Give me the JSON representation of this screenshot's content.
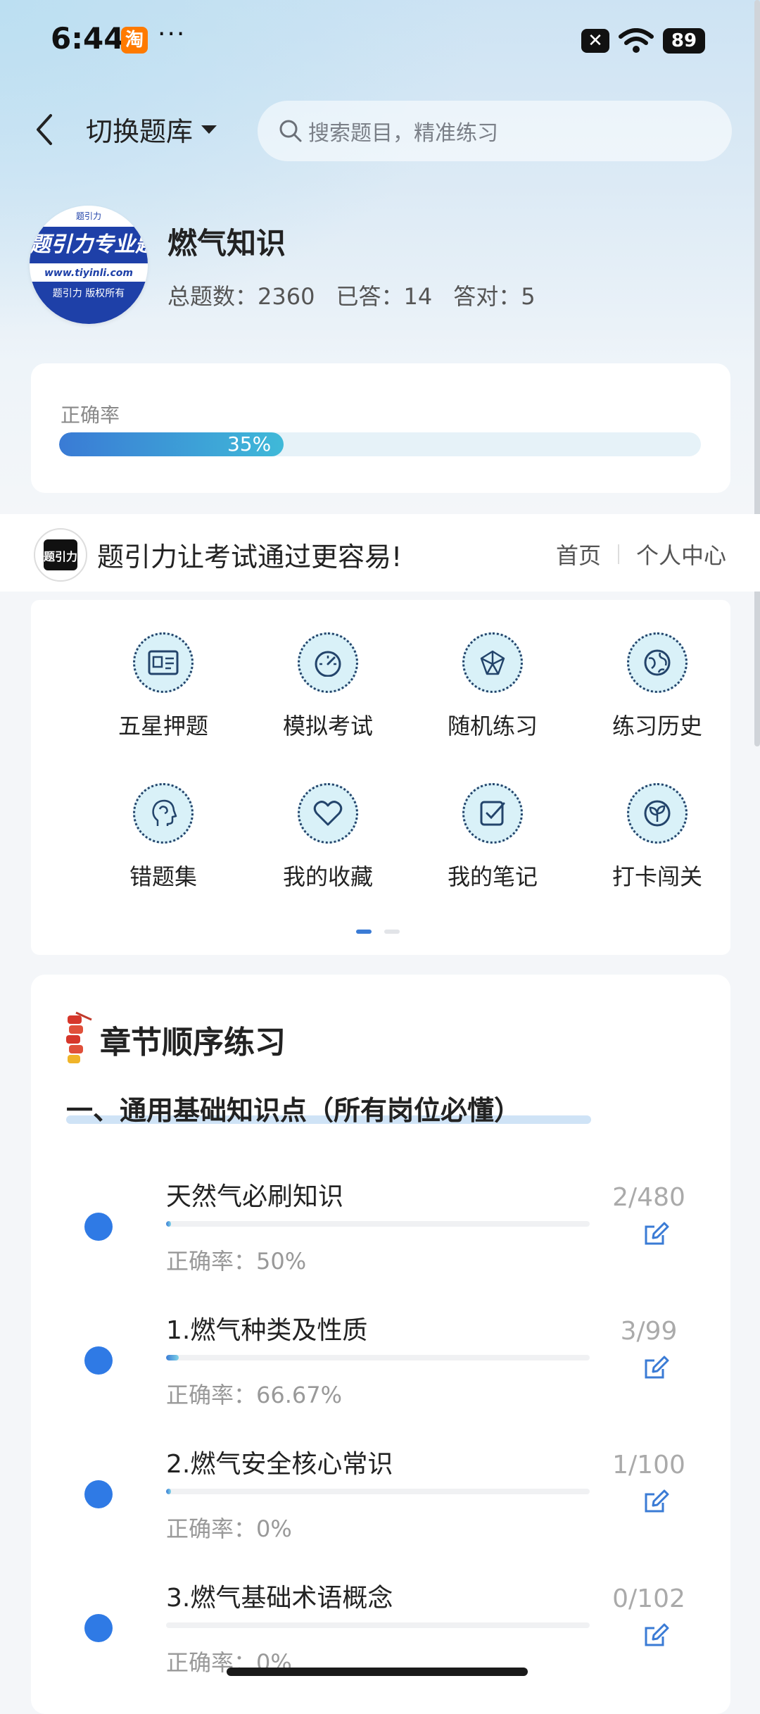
{
  "status_bar": {
    "time": "6:44",
    "app_badge": "淘",
    "more": "···",
    "battery": "89",
    "x_badge": "✕"
  },
  "nav": {
    "switch_label": "切换题库",
    "search_placeholder": "搜索题目，精准练习"
  },
  "bank": {
    "logo": {
      "top_mark": "题引力",
      "banner": "题引力专业题",
      "url": "www.tiyinli.com",
      "copyright": "题引力 版权所有"
    },
    "name": "燃气知识",
    "total_label": "总题数：2360",
    "answered_label": "已答：14",
    "correct_label": "答对：5"
  },
  "accuracy": {
    "label": "正确率",
    "percent_text": "35%",
    "percent": 35
  },
  "slogan": {
    "logo_text": "题引力",
    "text": "题引力让考试通过更容易!",
    "link_home": "首页",
    "link_profile": "个人中心"
  },
  "features": [
    {
      "label": "五星押题",
      "icon": "id-card-icon"
    },
    {
      "label": "模拟考试",
      "icon": "gauge-icon"
    },
    {
      "label": "随机练习",
      "icon": "network-icon"
    },
    {
      "label": "练习历史",
      "icon": "globe-icon"
    },
    {
      "label": "错题集",
      "icon": "head-icon"
    },
    {
      "label": "我的收藏",
      "icon": "heart-icon"
    },
    {
      "label": "我的笔记",
      "icon": "note-check-icon"
    },
    {
      "label": "打卡闯关",
      "icon": "sprout-icon"
    }
  ],
  "chapter": {
    "title": "章节顺序练习",
    "section": "一、通用基础知识点（所有岗位必懂）",
    "items": [
      {
        "name": "天然气必刷知识",
        "accuracy": "正确率：50%",
        "count": "2/480",
        "progress": 0.004
      },
      {
        "name": "1.燃气种类及性质",
        "accuracy": "正确率：66.67%",
        "count": "3/99",
        "progress": 0.03
      },
      {
        "name": "2.燃气安全核心常识",
        "accuracy": "正确率：0%",
        "count": "1/100",
        "progress": 0.01
      },
      {
        "name": "3.燃气基础术语概念",
        "accuracy": "正确率：0%",
        "count": "0/102",
        "progress": 0
      }
    ]
  },
  "colors": {
    "accent": "#3a7bd5",
    "dot": "#2f7ae5",
    "icon_fill": "#d9f1f8",
    "icon_stroke": "#23446b"
  }
}
